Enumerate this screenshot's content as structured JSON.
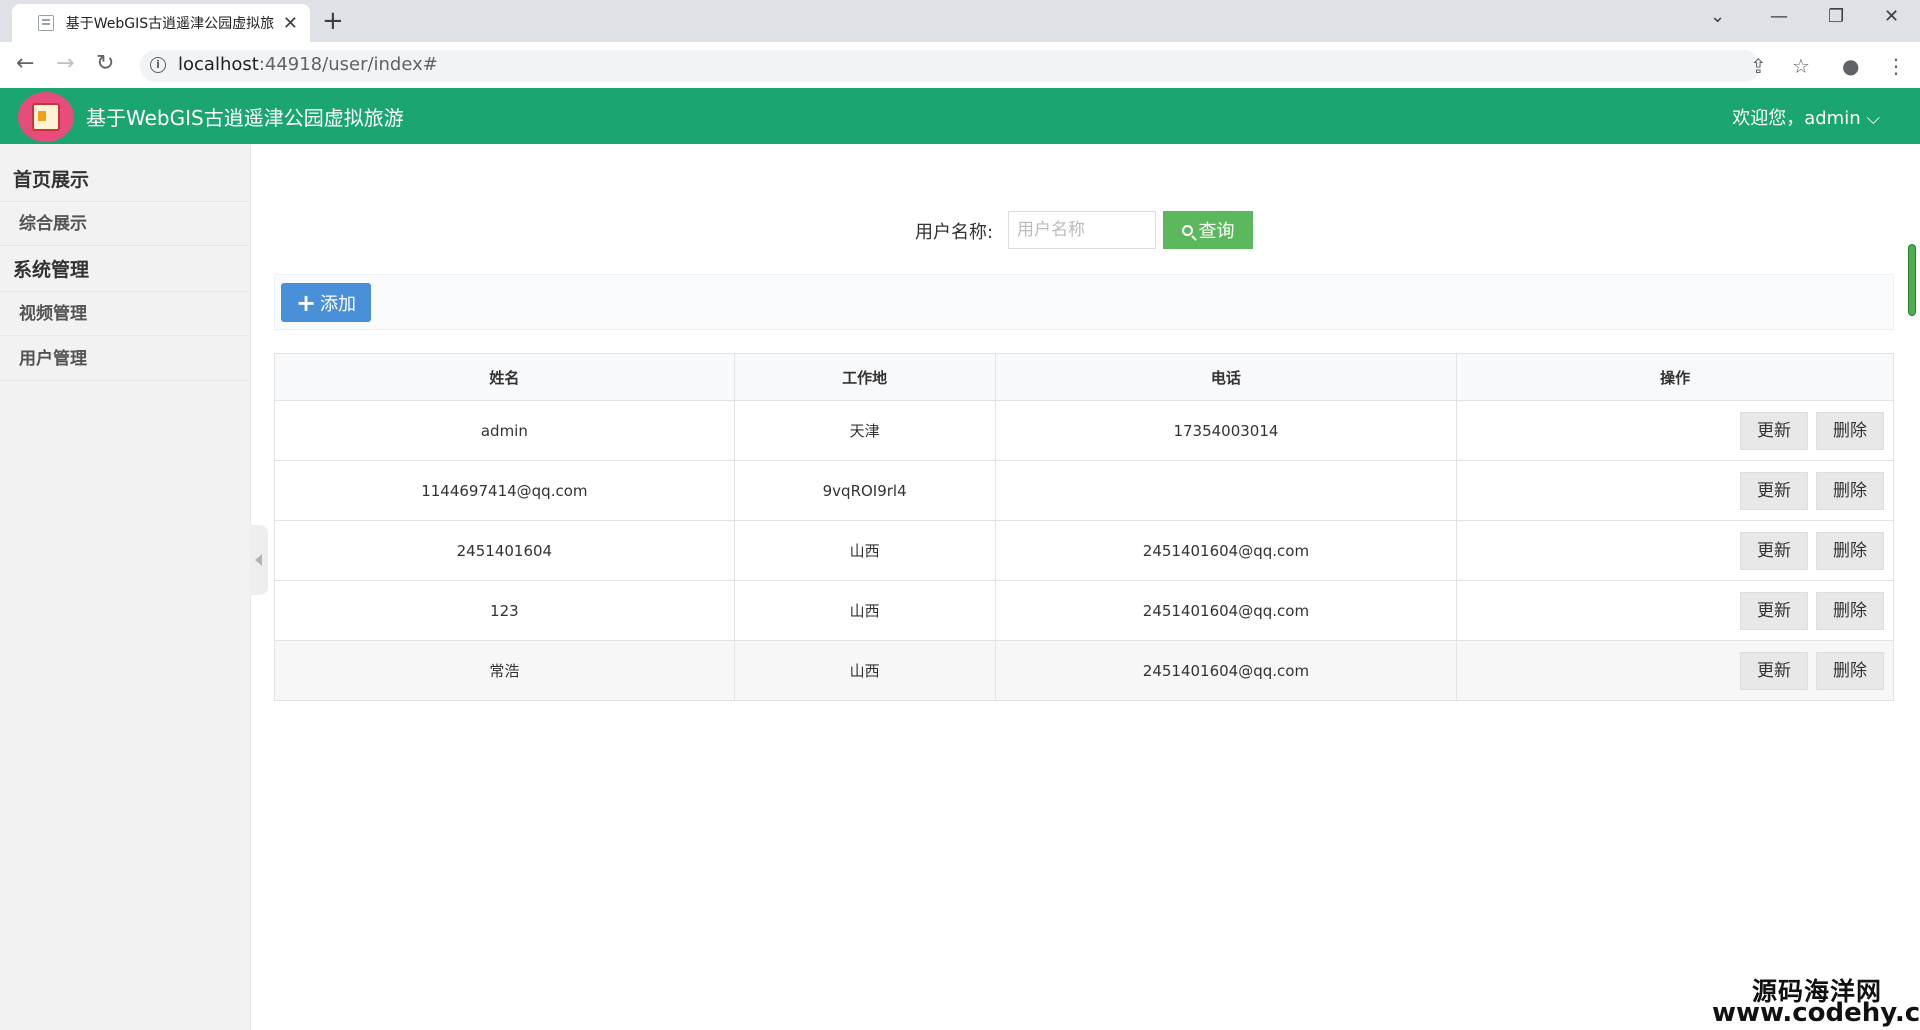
{
  "browser": {
    "tab_title": "基于WebGIS古逍遥津公园虚拟旅",
    "url_host": "localhost",
    "url_rest": ":44918/user/index#"
  },
  "app": {
    "title": "基于WebGIS古逍遥津公园虚拟旅游",
    "welcome": "欢迎您，admin",
    "brand_color": "#1aa571"
  },
  "sidebar": {
    "groups": [
      {
        "label": "首页展示",
        "items": [
          "综合展示"
        ]
      },
      {
        "label": "系统管理",
        "items": [
          "视频管理",
          "用户管理"
        ]
      }
    ]
  },
  "search": {
    "label": "用户名称:",
    "placeholder": "用户名称",
    "button": "查询"
  },
  "toolbar": {
    "add_label": "添加"
  },
  "table": {
    "columns": [
      "姓名",
      "工作地",
      "电话",
      "操作"
    ],
    "rows": [
      {
        "name": "admin",
        "place": "天津",
        "phone": "17354003014"
      },
      {
        "name": "1144697414@qq.com",
        "place": "9vqROI9rl4",
        "phone": ""
      },
      {
        "name": "2451401604",
        "place": "山西",
        "phone": "2451401604@qq.com"
      },
      {
        "name": "123",
        "place": "山西",
        "phone": "2451401604@qq.com"
      },
      {
        "name": "常浩",
        "place": "山西",
        "phone": "2451401604@qq.com"
      }
    ],
    "update_label": "更新",
    "delete_label": "删除"
  },
  "watermark": {
    "line1": "源码海洋网",
    "line2": "www.codehy.com"
  }
}
